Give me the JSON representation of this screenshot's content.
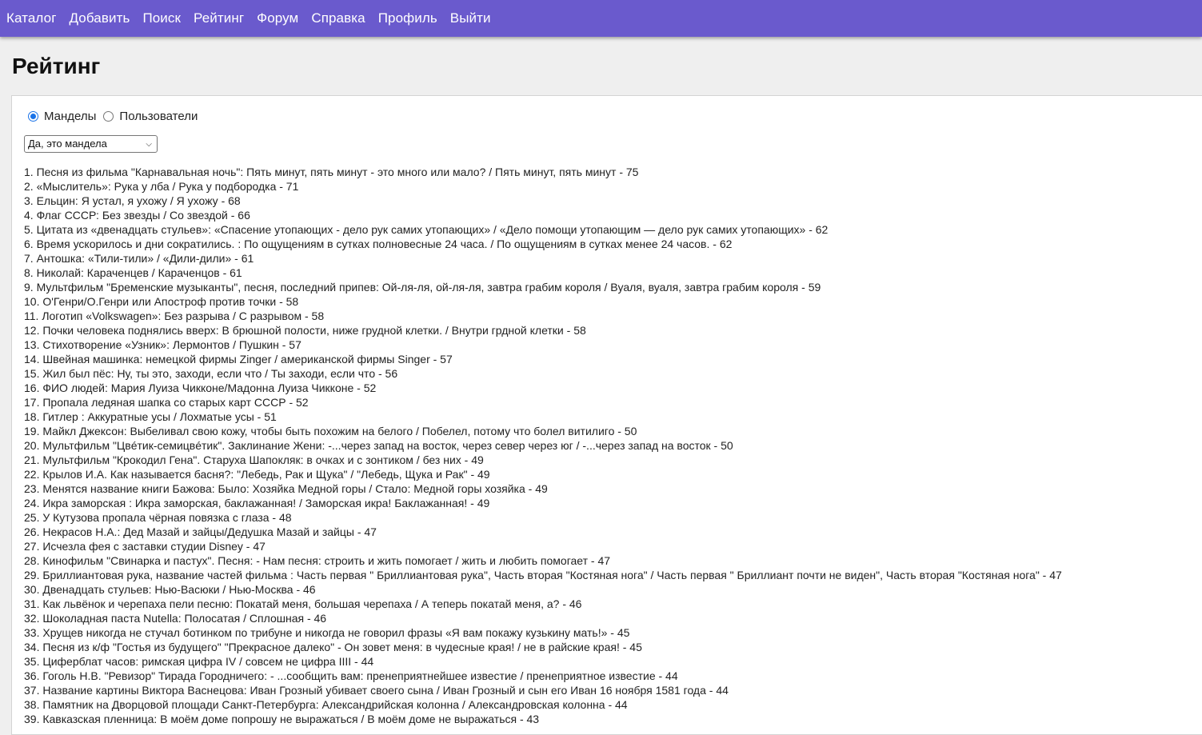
{
  "nav": [
    "Каталог",
    "Добавить",
    "Поиск",
    "Рейтинг",
    "Форум",
    "Справка",
    "Профиль",
    "Выйти"
  ],
  "page_title": "Рейтинг",
  "radios": [
    {
      "label": "Манделы",
      "checked": true
    },
    {
      "label": "Пользователи",
      "checked": false
    }
  ],
  "filter": {
    "selected": "Да, это мандела"
  },
  "rating": [
    "1. Песня из фильма \"Карнавальная ночь\": Пять минут, пять минут - это много или мало? / Пять минут, пять минут - 75",
    "2. «Мыслитель»: Рука у лба / Рука у подбородка - 71",
    "3. Ельцин: Я устал, я ухожу / Я ухожу - 68",
    "4. Флаг СССР: Без звезды / Со звездой - 66",
    "5. Цитата из «двенадцать стульев»: «Спасение утопающих - дело рук самих утопающих» / «Дело помощи утопающим — дело рук самих утопающих» - 62",
    "6. Время ускорилось и дни сократились. : По ощущениям в сутках полновесные 24 часа. / По ощущениям в сутках менее 24 часов. - 62",
    "7. Антошка: «Тили-тили» / «Дили-дили» - 61",
    "8. Николай: Караченцев / Караченцов - 61",
    "9. Мультфильм \"Бременские музыканты\", песня, последний припев: Ой-ля-ля, ой-ля-ля, завтра грабим короля / Вуаля, вуаля, завтра грабим короля - 59",
    "10. О'Генри/О.Генри или Апостроф против точки - 58",
    "11. Логотип «Volkswagen»: Без разрыва / С разрывом - 58",
    "12. Почки человека поднялись вверх: В брюшной полости, ниже грудной клетки. / Внутри грдной клетки - 58",
    "13. Стихотворение «Узник»: Лермонтов / Пушкин - 57",
    "14. Швейная машинка: немецкой фирмы Zinger / американской фирмы Singer - 57",
    "15. Жил был пёс: Ну, ты это, заходи, если что / Ты заходи, если что - 56",
    "16. ФИО людей: Мария Луиза Чикконе/Мадонна Луиза Чикконе - 52",
    "17. Пропала ледяная шапка со старых карт СССР - 52",
    "18. Гитлер : Аккуратные усы / Лохматые усы - 51",
    "19. Майкл Джексон: Выбеливал свою кожу, чтобы быть похожим на белого / Побелел, потому что болел витилиго - 50",
    "20. Мультфильм \"Цвéтик-семицвéтик\". Заклинание Жени: -...через запад на восток, через север через юг / -...через запад на восток - 50",
    "21. Мультфильм \"Крокодил Гена\". Старуха Шапокляк: в очках и с зонтиком / без них - 49",
    "22. Крылов И.А. Как называется басня?: \"Лебедь, Рак и Щука\" / \"Лебедь, Щука и Рак\" - 49",
    "23. Менятся название книги Бажова: Было: Хозяйка Медной горы / Стало: Медной горы хозяйка - 49",
    "24. Икра заморская : Икра заморская, баклажанная! / Заморская икра! Баклажанная! - 49",
    "25. У Кутузова пропала чёрная повязка с глаза - 48",
    "26. Некрасов Н.А.: Дед Мазай и зайцы/Дедушка Мазай и зайцы - 47",
    "27. Исчезла фея с заставки студии Disney - 47",
    "28. Кинофильм \"Свинарка и пастух\". Песня: - Нам песня: строить и жить помогает / жить и любить помогает - 47",
    "29. Бриллиантовая рука, название частей фильма : Часть первая \" Бриллиантовая рука\", Часть вторая \"Костяная нога\" / Часть первая \" Бриллиант почти не виден\", Часть вторая \"Костяная нога\" - 47",
    "30. Двенадцать стульев: Нью-Васюки / Нью-Москва - 46",
    "31. Как львёнок и черепаха пели песню: Покатай меня, большая черепаха / А теперь покатай меня, а? - 46",
    "32. Шоколадная паста Nutella: Полосатая / Сплошная - 46",
    "33. Хрущев никогда не стучал ботинком по трибуне и никогда не говорил фразы «Я вам покажу кузькину мать!» - 45",
    "34. Песня из к/ф \"Гостья из будущего\" \"Прекрасное далеко\" - Он зовет меня: в чудесные края! / не в райские края! - 45",
    "35. Циферблат часов: римская цифра IV / совсем не цифра IIII - 44",
    "36. Гоголь Н.В. \"Ревизор\" Тирада Городничего: - ...сообщить вам: пренеприятнейшее известие / пренеприятное известие - 44",
    "37. Название картины Виктора Васнецова: Иван Грозный убивает своего сына / Иван Грозный и сын его Иван 16 ноября 1581 года - 44",
    "38. Памятник на Дворцовой площади Санкт-Петербурга: Александрийская колонна / Александровская колонна - 44",
    "39. Кавказская пленница: В моём доме попрошу не выражаться / В моём доме не выражаться - 43"
  ]
}
